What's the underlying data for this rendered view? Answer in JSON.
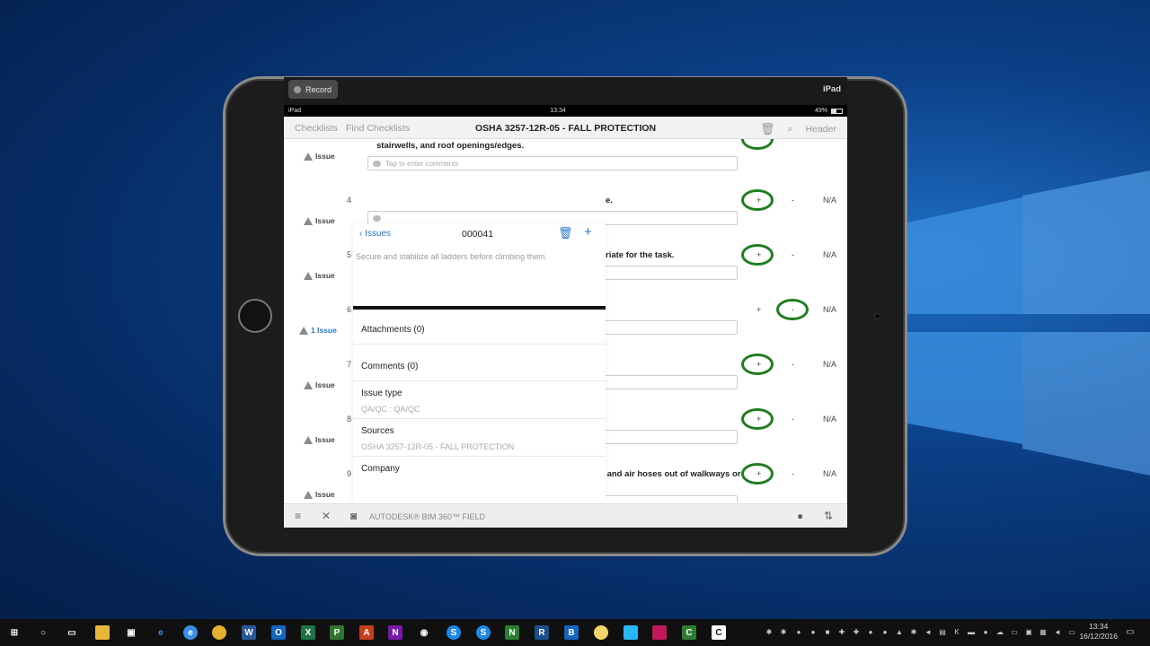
{
  "simulator": {
    "record_label": "Record",
    "device_label": "iPad"
  },
  "status_bar": {
    "carrier": "iPad",
    "time": "13:34",
    "battery": "49%"
  },
  "nav": {
    "left_1": "Checklists",
    "left_2": "Find Checklists",
    "title": "OSHA 3257-12R-05 - FALL PROTECTION",
    "right_label": "Header"
  },
  "checklist": {
    "comment_placeholder": "Tap to enter comments",
    "issue_label": "Issue",
    "plus_label": "+",
    "minus_label": "-",
    "na_label": "N/A",
    "rows": [
      {
        "num": "",
        "text": "stairwells, and roof openings/edges.",
        "issue": "Issue"
      },
      {
        "num": "4",
        "text": "e.",
        "issue": "Issue"
      },
      {
        "num": "5",
        "text": "riate for the task.",
        "issue": "Issue"
      },
      {
        "num": "6",
        "text": "",
        "issue": "1 Issue"
      },
      {
        "num": "7",
        "text": "",
        "issue": "Issue"
      },
      {
        "num": "8",
        "text": "",
        "issue": "Issue"
      },
      {
        "num": "9",
        "text": "Practice good housekeeping. Keep cords, welding leads and air hoses out of walkways or adjacent work areas.",
        "issue": "Issue"
      }
    ]
  },
  "popover": {
    "back_label": "Issues",
    "issue_id": "000041",
    "description": "Secure and stabilize all ladders before climbing them.",
    "attachments": "Attachments (0)",
    "comments": "Comments (0)",
    "issue_type_label": "Issue type",
    "issue_type_value": "QA/QC : QA/QC",
    "sources_label": "Sources",
    "sources_value": "OSHA 3257-12R-05 - FALL PROTECTION",
    "company_label": "Company"
  },
  "tab_bar": {
    "brand": "AUTODESK® BIM 360™ FIELD"
  },
  "taskbar": {
    "time": "13:34",
    "date": "16/12/2016"
  }
}
